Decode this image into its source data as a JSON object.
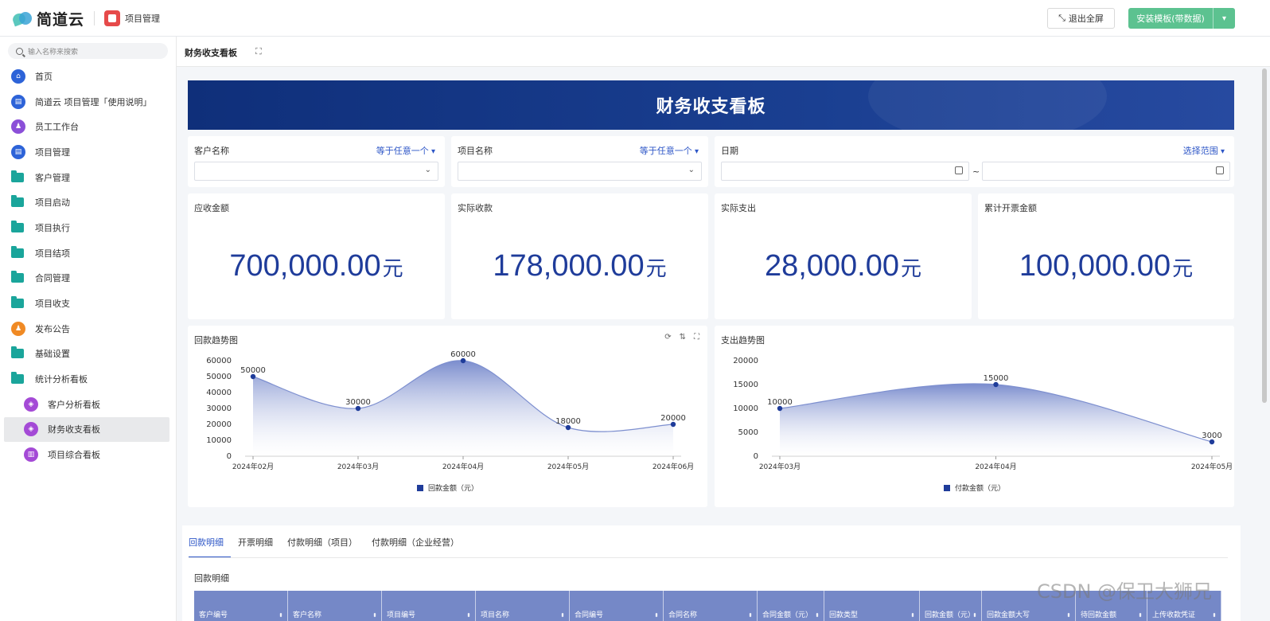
{
  "topbar": {
    "brand": "简道云",
    "app_name": "项目管理",
    "exit_fullscreen": "退出全屏",
    "install_template": "安装模板(带数据)"
  },
  "sidebar": {
    "search_placeholder": "输入名称来搜索",
    "items": [
      {
        "label": "首页",
        "icon": "home-icon",
        "color": "#2d63d8"
      },
      {
        "label": "简道云 项目管理「使用说明」",
        "icon": "doc-icon",
        "color": "#2d63d8"
      },
      {
        "label": "员工工作台",
        "icon": "user-icon",
        "color": "#8b4fd8"
      },
      {
        "label": "项目管理",
        "icon": "doc-icon",
        "color": "#2d63d8"
      },
      {
        "label": "客户管理",
        "icon": "folder-icon"
      },
      {
        "label": "项目启动",
        "icon": "folder-icon"
      },
      {
        "label": "项目执行",
        "icon": "folder-icon"
      },
      {
        "label": "项目结项",
        "icon": "folder-icon"
      },
      {
        "label": "合同管理",
        "icon": "folder-icon"
      },
      {
        "label": "项目收支",
        "icon": "folder-icon"
      },
      {
        "label": "发布公告",
        "icon": "announce-icon",
        "color": "#f08a24"
      },
      {
        "label": "基础设置",
        "icon": "folder-icon"
      },
      {
        "label": "统计分析看板",
        "icon": "folder-icon"
      },
      {
        "label": "客户分析看板",
        "icon": "dashboard-icon",
        "color": "#a44ad6"
      },
      {
        "label": "财务收支看板",
        "icon": "dashboard-icon",
        "color": "#a44ad6"
      },
      {
        "label": "项目综合看板",
        "icon": "chart-icon",
        "color": "#a44ad6"
      }
    ]
  },
  "page": {
    "title": "财务收支看板",
    "banner": "财务收支看板"
  },
  "filters": [
    {
      "label": "客户名称",
      "op": "等于任意一个"
    },
    {
      "label": "项目名称",
      "op": "等于任意一个"
    },
    {
      "label": "日期",
      "op": "选择范围",
      "range_sep": "~"
    }
  ],
  "kpis": [
    {
      "label": "应收金额",
      "value": "700,000.00",
      "unit": "元"
    },
    {
      "label": "实际收款",
      "value": "178,000.00",
      "unit": "元"
    },
    {
      "label": "实际支出",
      "value": "28,000.00",
      "unit": "元"
    },
    {
      "label": "累计开票金额",
      "value": "100,000.00",
      "unit": "元"
    }
  ],
  "chart_data": [
    {
      "type": "area",
      "title": "回款趋势图",
      "categories": [
        "2024年02月",
        "2024年03月",
        "2024年04月",
        "2024年05月",
        "2024年06月"
      ],
      "series": [
        {
          "name": "回款金额（元）",
          "values": [
            50000,
            30000,
            60000,
            18000,
            20000
          ]
        }
      ],
      "yticks": [
        0,
        10000,
        20000,
        30000,
        40000,
        50000,
        60000
      ],
      "ylim": [
        0,
        60000
      ],
      "legend": "bottom",
      "color": "#1f3c9a"
    },
    {
      "type": "area",
      "title": "支出趋势图",
      "categories": [
        "2024年03月",
        "2024年04月",
        "2024年05月"
      ],
      "series": [
        {
          "name": "付款金额（元）",
          "values": [
            10000,
            15000,
            3000
          ]
        }
      ],
      "yticks": [
        0,
        5000,
        10000,
        15000,
        20000
      ],
      "ylim": [
        0,
        20000
      ],
      "legend": "bottom",
      "color": "#1f3c9a"
    }
  ],
  "tabs": [
    "回款明细",
    "开票明细",
    "付款明细（项目）",
    "付款明细（企业经营）"
  ],
  "table": {
    "title": "回款明细",
    "columns": [
      "客户编号",
      "客户名称",
      "项目编号",
      "项目名称",
      "合同编号",
      "合同名称",
      "合同金额（元）",
      "回款类型",
      "回款金额（元）",
      "回款金额大写",
      "待回款金额",
      "上传收款凭证"
    ]
  },
  "watermark": "CSDN @保卫大狮兄"
}
